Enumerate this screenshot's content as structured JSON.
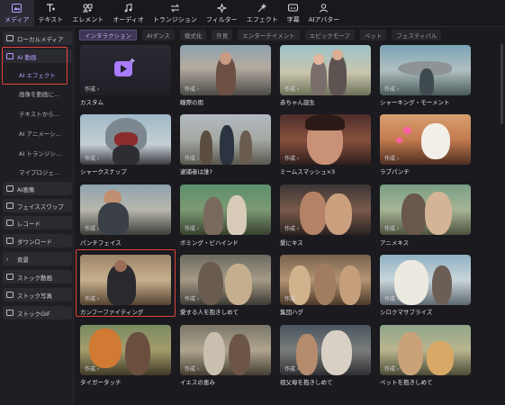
{
  "toolbar": {
    "items": [
      {
        "label": "メディア",
        "icon": "media-icon",
        "active": true
      },
      {
        "label": "テキスト",
        "icon": "text-icon"
      },
      {
        "label": "エレメント",
        "icon": "element-icon"
      },
      {
        "label": "オーディオ",
        "icon": "audio-icon"
      },
      {
        "label": "トランジション",
        "icon": "transition-icon"
      },
      {
        "label": "フィルター",
        "icon": "filter-icon"
      },
      {
        "label": "エフェクト",
        "icon": "effect-icon"
      },
      {
        "label": "字幕",
        "icon": "subtitle-icon"
      },
      {
        "label": "AIアバター",
        "icon": "avatar-icon"
      }
    ]
  },
  "sidebar": {
    "local_media": "ローカルメディア",
    "ai_video": "AI 動画",
    "ai_effect": "AI エフェクト",
    "sub1": "画像を動画に...",
    "sub2": "テキストから...",
    "sub3": "AI アニメーシ...",
    "sub4": "AI トランジシ...",
    "sub5": "マイプロジェ...",
    "ai_image": "AI画像",
    "face_swap": "フェイススワップ",
    "record": "レコード",
    "download": "ダウンロード",
    "background": "背景",
    "stock_video": "ストック動画",
    "stock_photo": "ストック写真",
    "stock_gif": "ストックGIF"
  },
  "tabs": [
    "インタラクション",
    "AIダンス",
    "様式化",
    "外見",
    "エンターテイメント",
    "エピックモーフ",
    "ペット",
    "フェスティバル"
  ],
  "create_label": "作成",
  "cards": [
    "カスタム",
    "瞳際の雨",
    "赤ちゃん誕生",
    "シャーキング・モーメント",
    "シャークスナップ",
    "逮捕者は誰?",
    "ミームスマッシュ×3",
    "ラブパンチ",
    "パンチフェイス",
    "ボミング・ビハインド",
    "愛にキス",
    "アニメキス",
    "カンフーファイティング",
    "愛する人を抱きしめて",
    "集団ハグ",
    "シロクマサプライズ",
    "タイガータッチ",
    "イエスの恵み",
    "祖父母を抱きしめて",
    "ペットを抱きしめて"
  ],
  "colors": {
    "accent": "#b69bff",
    "highlight_border": "#e0463c",
    "background": "#1a1a1f"
  }
}
